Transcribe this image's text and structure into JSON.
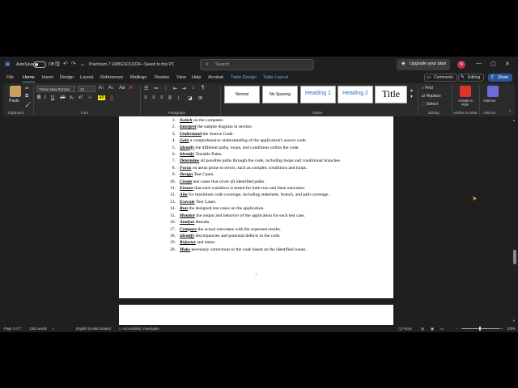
{
  "titlebar": {
    "autosave_label": "AutoSave",
    "autosave_state": "Off",
    "doc_title": "Practicum 7 URBGSCS1024  •  Saved to this PC",
    "search_placeholder": "Search",
    "upgrade_label": "Upgrade your plan",
    "avatar_initials": "N"
  },
  "menubar": {
    "tabs": [
      "File",
      "Home",
      "Insert",
      "Design",
      "Layout",
      "References",
      "Mailings",
      "Review",
      "View",
      "Help",
      "Acrobat",
      "Table Design",
      "Table Layout"
    ],
    "comments_label": "Comments",
    "editing_label": "Editing",
    "share_label": "Share"
  },
  "ribbon": {
    "clipboard": {
      "paste_label": "Paste",
      "group_label": "Clipboard"
    },
    "font": {
      "font_name": "Times New Roman",
      "font_size": "12",
      "group_label": "Font"
    },
    "paragraph": {
      "group_label": "Paragraph"
    },
    "styles": {
      "items": [
        "Normal",
        "No Spacing",
        "Heading 1",
        "Heading 2",
        "Title"
      ],
      "group_label": "Styles"
    },
    "editing": {
      "find_label": "Find",
      "replace_label": "Replace",
      "select_label": "Select",
      "group_label": "Editing"
    },
    "acrobat": {
      "create_pdf_label": "Create a PDF",
      "group_label": "Adobe Acrobat"
    },
    "addins": {
      "label": "Add-ins",
      "group_label": "Add-ins"
    }
  },
  "document": {
    "items": [
      {
        "n": "1.",
        "key": "Switch",
        "rest": " on the computer."
      },
      {
        "n": "2.",
        "key": "Interpret",
        "rest": " the sample diagram in section."
      },
      {
        "n": "3.",
        "key": "Understand",
        "rest": " the Source Code."
      },
      {
        "n": "4.",
        "key": "Gain",
        "rest": " a comprehensive understanding of the application's source code."
      },
      {
        "n": "5.",
        "key": "Identify",
        "rest": " the different paths, loops, and conditions within the code."
      },
      {
        "n": "6.",
        "key": "Identify",
        "rest": " Testable Paths."
      },
      {
        "n": "7.",
        "key": "Determine",
        "rest": " all possible paths through the code, including loops and conditional branches."
      },
      {
        "n": "8.",
        "key": "Focus",
        "rest": " on areas prone to errors, such as complex conditions and loops."
      },
      {
        "n": "9.",
        "key": "Design",
        "rest": " Test Cases."
      },
      {
        "n": "10.",
        "key": "Create",
        "rest": " test cases that cover all identified paths."
      },
      {
        "n": "11.",
        "key": "Ensure",
        "rest": " that each condition is tested for both true and false outcomes."
      },
      {
        "n": "12.",
        "key": "Aim",
        "rest": " for maximum code coverage, including statement, branch, and path coverage."
      },
      {
        "n": "13.",
        "key": "Execute",
        "rest": " Test Cases."
      },
      {
        "n": "14.",
        "key": "Run",
        "rest": " the designed test cases on the application."
      },
      {
        "n": "15.",
        "key": "Monitor",
        "rest": " the output and behavior of the application for each test case."
      },
      {
        "n": "16.",
        "key": "Analyze",
        "rest": " Results."
      },
      {
        "n": "17.",
        "key": "Compare",
        "rest": " the actual outcomes with the expected results."
      },
      {
        "n": "18.",
        "key": "Identify",
        "rest": " discrepancies and potential defects in the code."
      },
      {
        "n": "19.",
        "key": "Refactor",
        "rest": " and retest."
      },
      {
        "n": "20.",
        "key": "Make",
        "rest": " necessary corrections to the code based on the identified issues."
      }
    ],
    "page_number": "3"
  },
  "statusbar": {
    "page": "Page 3 of 7",
    "words": "1361 words",
    "language": "English (United States)",
    "accessibility": "Accessibility: Investigate",
    "focus": "Focus",
    "zoom": "100%"
  },
  "colors": {
    "accent": "#2b5797",
    "avatar": "#c4314b",
    "heading": "#2e74b5"
  }
}
